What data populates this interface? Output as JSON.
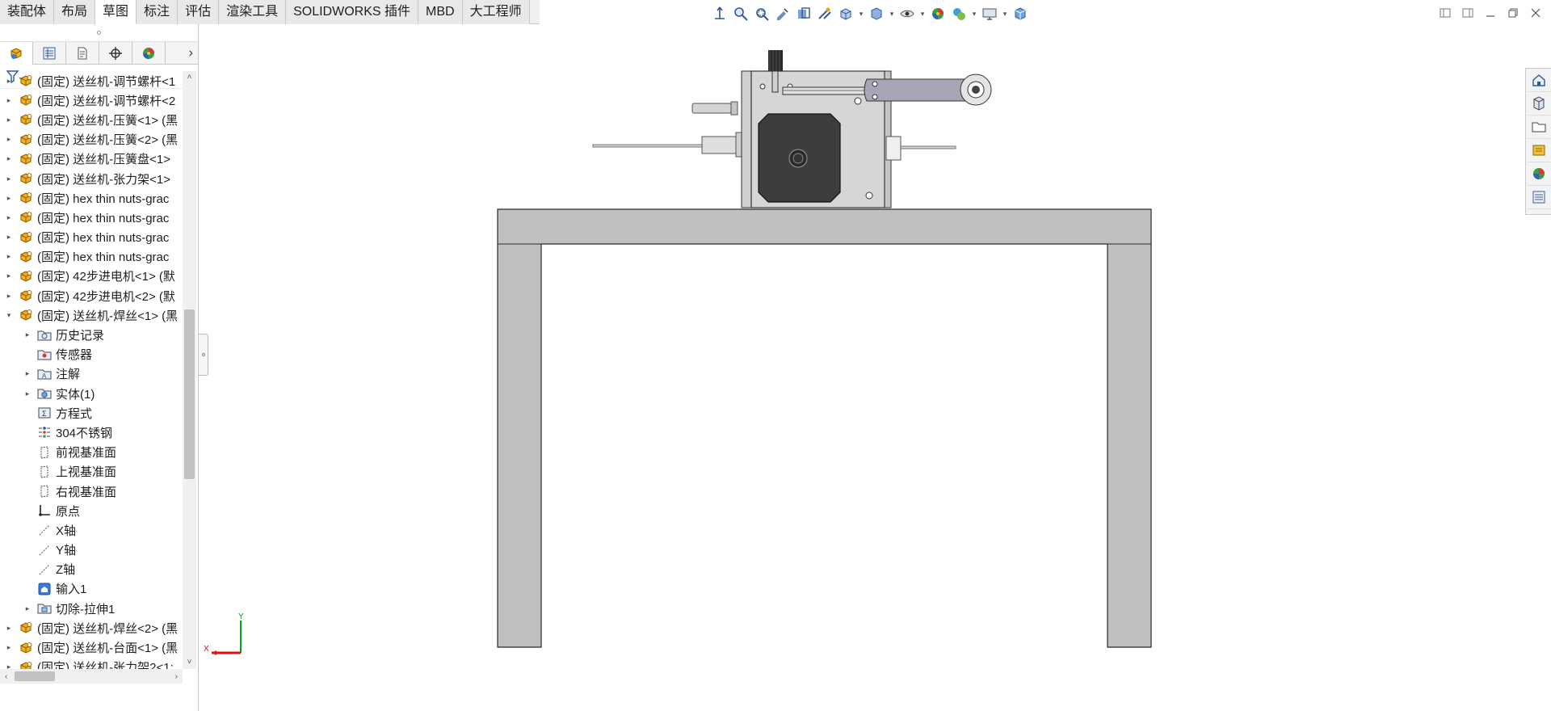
{
  "ribbon": {
    "tabs": [
      {
        "label": "装配体"
      },
      {
        "label": "布局"
      },
      {
        "label": "草图",
        "active": true
      },
      {
        "label": "标注"
      },
      {
        "label": "评估"
      },
      {
        "label": "渲染工具"
      },
      {
        "label": "SOLIDWORKS 插件"
      },
      {
        "label": "MBD"
      },
      {
        "label": "大工程师"
      }
    ]
  },
  "view_toolbar": {
    "icons": [
      "view-orientation-origin-icon",
      "zoom-to-fit-icon",
      "zoom-to-area-icon",
      "previous-view-icon",
      "section-view-icon",
      "dynamic-annotation-icon",
      "view-orientation-icon",
      "display-style-icon",
      "hide-show-icon",
      "edit-appearance-icon",
      "apply-scene-icon",
      "view-settings-icon",
      "3d-view-icon"
    ]
  },
  "feature_manager": {
    "tabs": [
      "featuremanager-tree-icon",
      "property-manager-icon",
      "configuration-manager-icon",
      "dimxpert-icon",
      "display-manager-icon"
    ],
    "tree": [
      {
        "label": "(固定) 送丝机-调节螺杆<1",
        "level": 0,
        "expander": "▸",
        "icon": "part-icon"
      },
      {
        "label": "(固定) 送丝机-调节螺杆<2",
        "level": 0,
        "expander": "▸",
        "icon": "part-icon"
      },
      {
        "label": "(固定) 送丝机-压簧<1> (黑",
        "level": 0,
        "expander": "▸",
        "icon": "part-icon"
      },
      {
        "label": "(固定) 送丝机-压簧<2> (黑",
        "level": 0,
        "expander": "▸",
        "icon": "part-icon"
      },
      {
        "label": "(固定) 送丝机-压簧盘<1>",
        "level": 0,
        "expander": "▸",
        "icon": "part-icon"
      },
      {
        "label": "(固定) 送丝机-张力架<1>",
        "level": 0,
        "expander": "▸",
        "icon": "part-icon"
      },
      {
        "label": "(固定) hex thin nuts-grac",
        "level": 0,
        "expander": "▸",
        "icon": "part-icon"
      },
      {
        "label": "(固定) hex thin nuts-grac",
        "level": 0,
        "expander": "▸",
        "icon": "part-icon"
      },
      {
        "label": "(固定) hex thin nuts-grac",
        "level": 0,
        "expander": "▸",
        "icon": "part-icon"
      },
      {
        "label": "(固定) hex thin nuts-grac",
        "level": 0,
        "expander": "▸",
        "icon": "part-icon"
      },
      {
        "label": "(固定) 42步进电机<1> (默",
        "level": 0,
        "expander": "▸",
        "icon": "part-icon"
      },
      {
        "label": "(固定) 42步进电机<2> (默",
        "level": 0,
        "expander": "▸",
        "icon": "part-icon"
      },
      {
        "label": "(固定) 送丝机-焊丝<1> (黑",
        "level": 0,
        "expander": "▾",
        "icon": "part-icon"
      },
      {
        "label": "历史记录",
        "level": 1,
        "expander": "▸",
        "icon": "history-folder-icon"
      },
      {
        "label": "传感器",
        "level": 1,
        "expander": "",
        "icon": "sensor-folder-icon"
      },
      {
        "label": "注解",
        "level": 1,
        "expander": "▸",
        "icon": "annotation-folder-icon"
      },
      {
        "label": "实体(1)",
        "level": 1,
        "expander": "▸",
        "icon": "solid-bodies-folder-icon"
      },
      {
        "label": "方程式",
        "level": 1,
        "expander": "",
        "icon": "equations-folder-icon"
      },
      {
        "label": "304不锈钢",
        "level": 1,
        "expander": "",
        "icon": "material-icon"
      },
      {
        "label": "前视基准面",
        "level": 1,
        "expander": "",
        "icon": "plane-icon"
      },
      {
        "label": "上视基准面",
        "level": 1,
        "expander": "",
        "icon": "plane-icon"
      },
      {
        "label": "右视基准面",
        "level": 1,
        "expander": "",
        "icon": "plane-icon"
      },
      {
        "label": "原点",
        "level": 1,
        "expander": "",
        "icon": "origin-icon"
      },
      {
        "label": "X轴",
        "level": 1,
        "expander": "",
        "icon": "axis-icon"
      },
      {
        "label": "Y轴",
        "level": 1,
        "expander": "",
        "icon": "axis-icon"
      },
      {
        "label": "Z轴",
        "level": 1,
        "expander": "",
        "icon": "axis-icon"
      },
      {
        "label": "输入1",
        "level": 1,
        "expander": "",
        "icon": "imported-feature-icon"
      },
      {
        "label": "切除-拉伸1",
        "level": 1,
        "expander": "▸",
        "icon": "cut-extrude-icon"
      },
      {
        "label": "(固定) 送丝机-焊丝<2> (黑",
        "level": 0,
        "expander": "▸",
        "icon": "part-icon"
      },
      {
        "label": "(固定) 送丝机-台面<1> (黑",
        "level": 0,
        "expander": "▸",
        "icon": "part-icon"
      },
      {
        "label": "(固定) 送丝机-张力架2<1:",
        "level": 0,
        "expander": "▸",
        "icon": "part-icon"
      }
    ]
  },
  "task_pane": {
    "icons": [
      "solidworks-resources-icon",
      "design-library-icon",
      "file-explorer-icon",
      "view-palette-icon",
      "appearances-scenes-icon",
      "custom-properties-icon"
    ]
  },
  "triad": {
    "x_label": "X",
    "y_label": "Y"
  },
  "colors": {
    "table": "#c0c0c0",
    "housing": "#d6d6d6",
    "motor": "#3d3d3d",
    "arm": "#a6a6b8",
    "axis_x": "#e01010",
    "axis_y": "#10a010"
  }
}
